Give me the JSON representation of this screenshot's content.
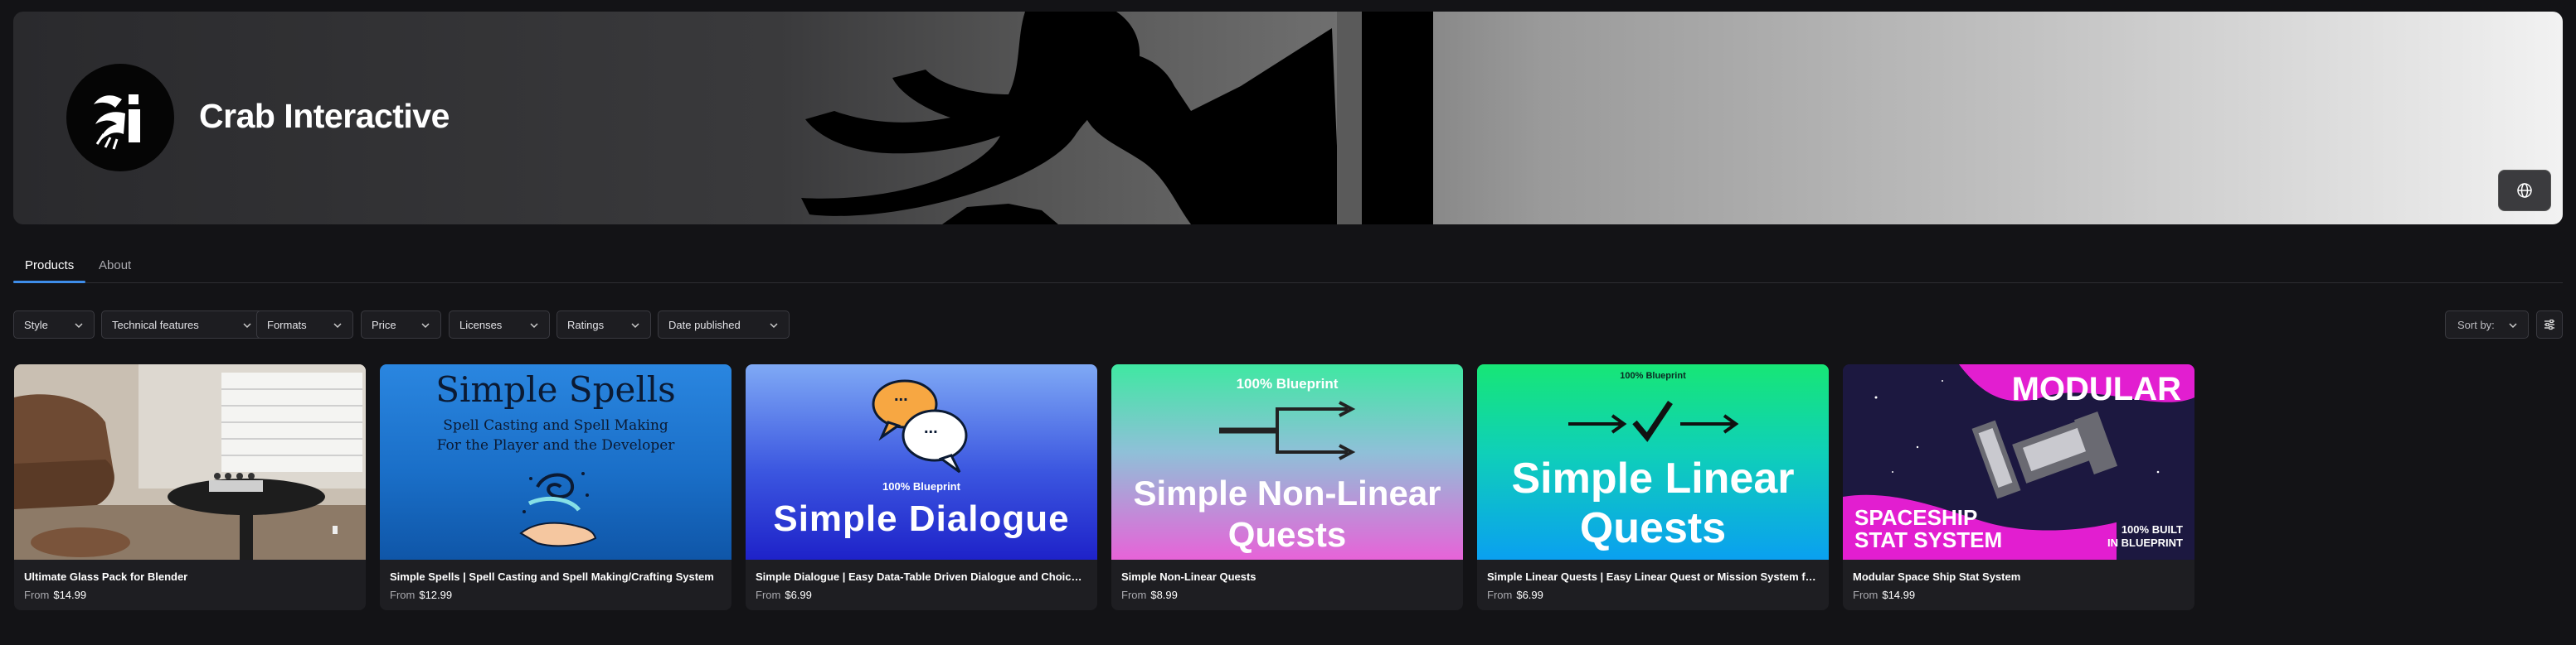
{
  "studio": {
    "name": "Crab Interactive"
  },
  "tabs": [
    {
      "label": "Products",
      "active": true
    },
    {
      "label": "About",
      "active": false
    }
  ],
  "filters": [
    {
      "label": "Style"
    },
    {
      "label": "Technical features"
    },
    {
      "label": "Formats"
    },
    {
      "label": "Price"
    },
    {
      "label": "Licenses"
    },
    {
      "label": "Ratings"
    },
    {
      "label": "Date published"
    }
  ],
  "sort": {
    "label": "Sort by:"
  },
  "products": [
    {
      "title": "Ultimate Glass Pack for Blender",
      "from_label": "From",
      "price": "$14.99"
    },
    {
      "title": "Simple Spells | Spell Casting and Spell Making/Crafting System",
      "from_label": "From",
      "price": "$12.99",
      "thumb": {
        "heading": "Simple Spells",
        "line1": "Spell Casting and Spell Making",
        "line2": "For the Player and the Developer"
      }
    },
    {
      "title": "Simple Dialogue | Easy Data-Table Driven Dialogue and Choice System",
      "from_label": "From",
      "price": "$6.99",
      "thumb": {
        "tag": "100% Blueprint",
        "heading": "Simple Dialogue",
        "bubble": "..."
      }
    },
    {
      "title": "Simple Non-Linear Quests",
      "from_label": "From",
      "price": "$8.99",
      "thumb": {
        "tag": "100% Blueprint",
        "line1": "Simple Non-Linear",
        "line2": "Quests"
      }
    },
    {
      "title": "Simple Linear Quests | Easy Linear Quest or Mission System for UE",
      "from_label": "From",
      "price": "$6.99",
      "thumb": {
        "tag": "100% Blueprint",
        "line1": "Simple Linear",
        "line2": "Quests"
      }
    },
    {
      "title": "Modular Space Ship Stat System",
      "from_label": "From",
      "price": "$14.99",
      "thumb": {
        "heading": "MODULAR",
        "line1": "SPACESHIP",
        "line2": "STAT SYSTEM",
        "badge1": "100% BUILT",
        "badge2": "IN BLUEPRINT"
      }
    }
  ],
  "colors": {
    "accent": "#3e8dea",
    "background": "#131316",
    "card": "#1e1e22"
  }
}
